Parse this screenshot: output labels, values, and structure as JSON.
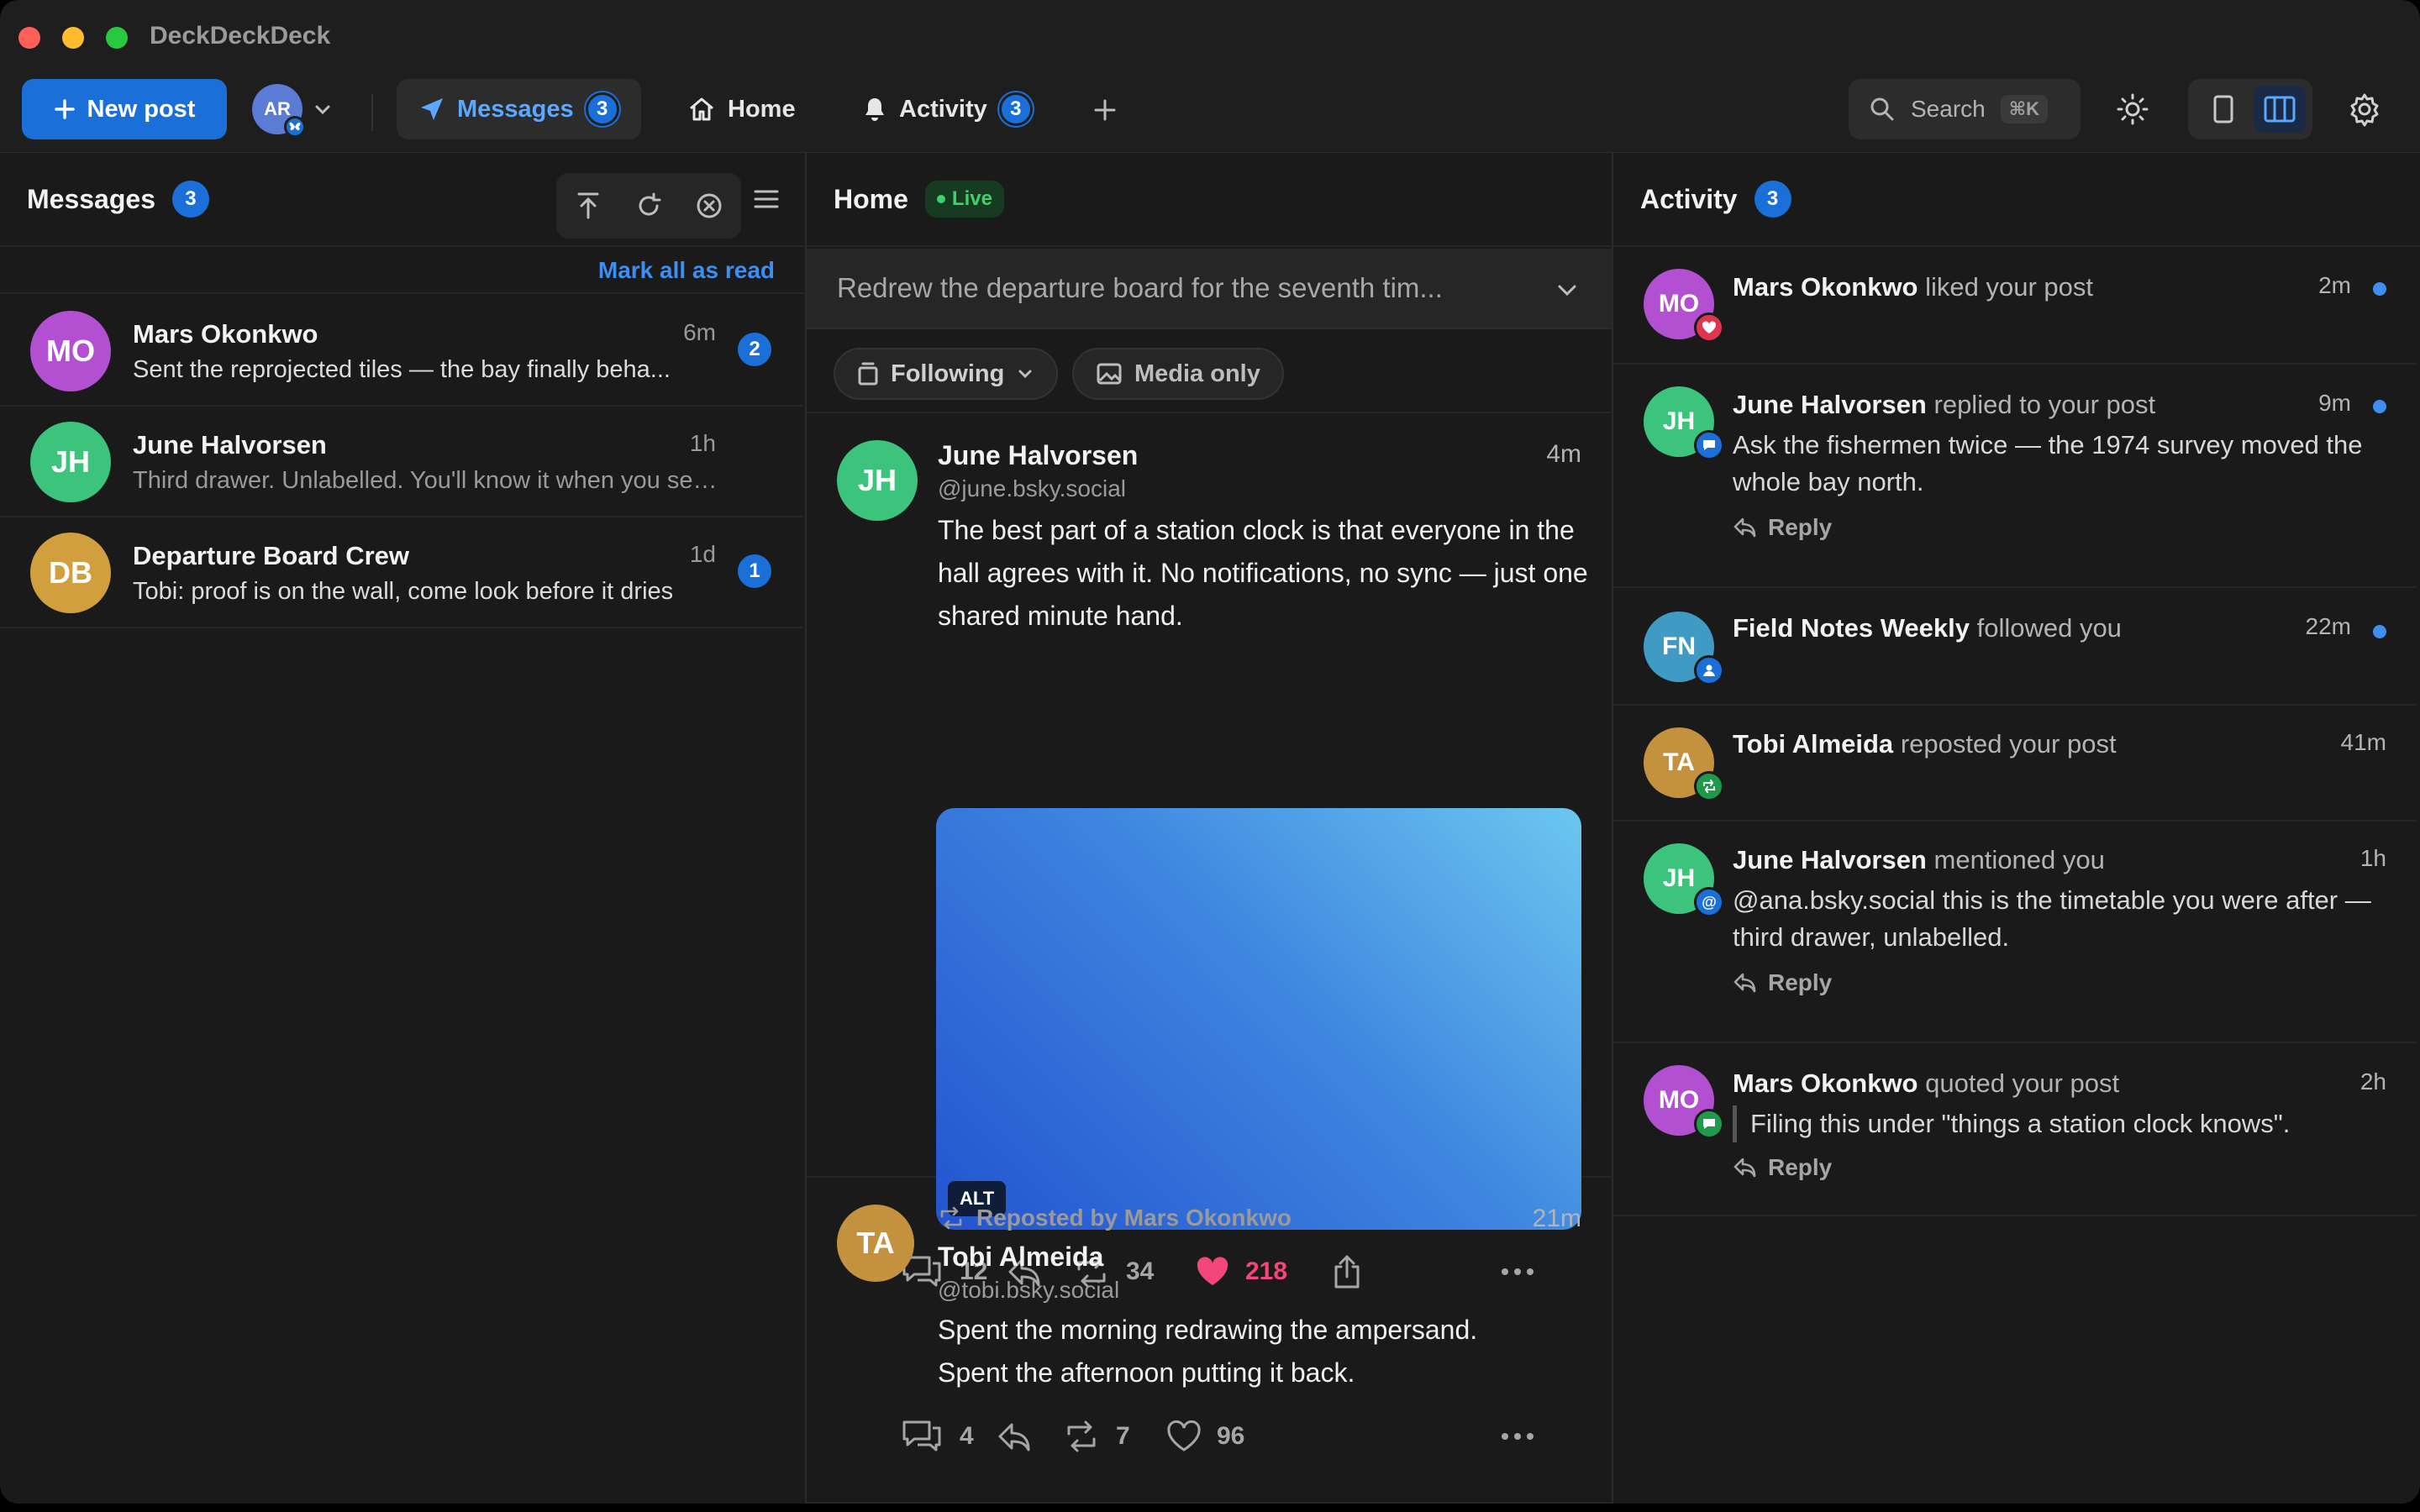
{
  "window": {
    "title": "DeckDeckDeck"
  },
  "toolbar": {
    "new_post_label": "New post",
    "account_initials": "AR",
    "tabs": [
      {
        "label": "Messages",
        "badge": "3",
        "active": true
      },
      {
        "label": "Home"
      },
      {
        "label": "Activity",
        "badge": "3"
      }
    ],
    "search_label": "Search",
    "search_shortcut": "⌘K"
  },
  "messages_column": {
    "title": "Messages",
    "badge": "3",
    "mark_all_read": "Mark all as read",
    "conversations": [
      {
        "initials": "MO",
        "name": "Mars Okonkwo",
        "time": "6m",
        "preview": "Sent the reprojected tiles — the bay finally beha...",
        "unread": "2"
      },
      {
        "initials": "JH",
        "name": "June Halvorsen",
        "time": "1h",
        "preview": "Third drawer. Unlabelled. You'll know it when you see..."
      },
      {
        "initials": "DB",
        "name": "Departure Board Crew",
        "time": "1d",
        "preview": "Tobi: proof is on the wall, come look before it dries",
        "unread": "1"
      }
    ]
  },
  "home_column": {
    "title": "Home",
    "live_label": "Live",
    "composer_preview": "Redrew the departure board for the seventh tim...",
    "filters": {
      "following": "Following",
      "media_only": "Media only"
    },
    "posts": [
      {
        "initials": "JH",
        "name": "June Halvorsen",
        "handle": "@june.bsky.social",
        "time": "4m",
        "text": "The best part of a station clock is that everyone in the hall agrees with it. No notifications, no sync — just one shared minute hand.",
        "alt_badge": "ALT",
        "replies": "12",
        "reposts": "34",
        "likes": "218"
      },
      {
        "initials": "TA",
        "repost_note": "Reposted by Mars Okonkwo",
        "name": "Tobi Almeida",
        "handle": "@tobi.bsky.social",
        "time": "21m",
        "text_line1": "Spent the morning redrawing the ampersand.",
        "text_line2": "Spent the afternoon putting it back.",
        "replies": "4",
        "reposts": "7",
        "likes": "96"
      }
    ]
  },
  "activity_column": {
    "title": "Activity",
    "badge": "3",
    "reply_label": "Reply",
    "items": [
      {
        "initials": "MO",
        "name": "Mars Okonkwo",
        "action": "liked your post",
        "time": "2m"
      },
      {
        "initials": "JH",
        "name": "June Halvorsen",
        "action": "replied to your post",
        "time": "9m",
        "body": "Ask the fishermen twice — the 1974 survey moved the whole bay north."
      },
      {
        "initials": "FN",
        "name": "Field Notes Weekly",
        "action": "followed you",
        "time": "22m"
      },
      {
        "initials": "TA",
        "name": "Tobi Almeida",
        "action": "reposted your post",
        "time": "41m"
      },
      {
        "initials": "JH",
        "name": "June Halvorsen",
        "action": "mentioned you",
        "time": "1h",
        "body": "@ana.bsky.social this is the timetable you were after — third drawer, unlabelled."
      },
      {
        "initials": "MO",
        "name": "Mars Okonkwo",
        "action": "quoted your post",
        "time": "2h",
        "body": "Filing this under \"things a station clock knows\"."
      }
    ]
  },
  "colors": {
    "accent": "#1a6fd8",
    "like": "#f4467a",
    "live": "#3ed36a",
    "unread_dot": "#3d8ef0"
  }
}
